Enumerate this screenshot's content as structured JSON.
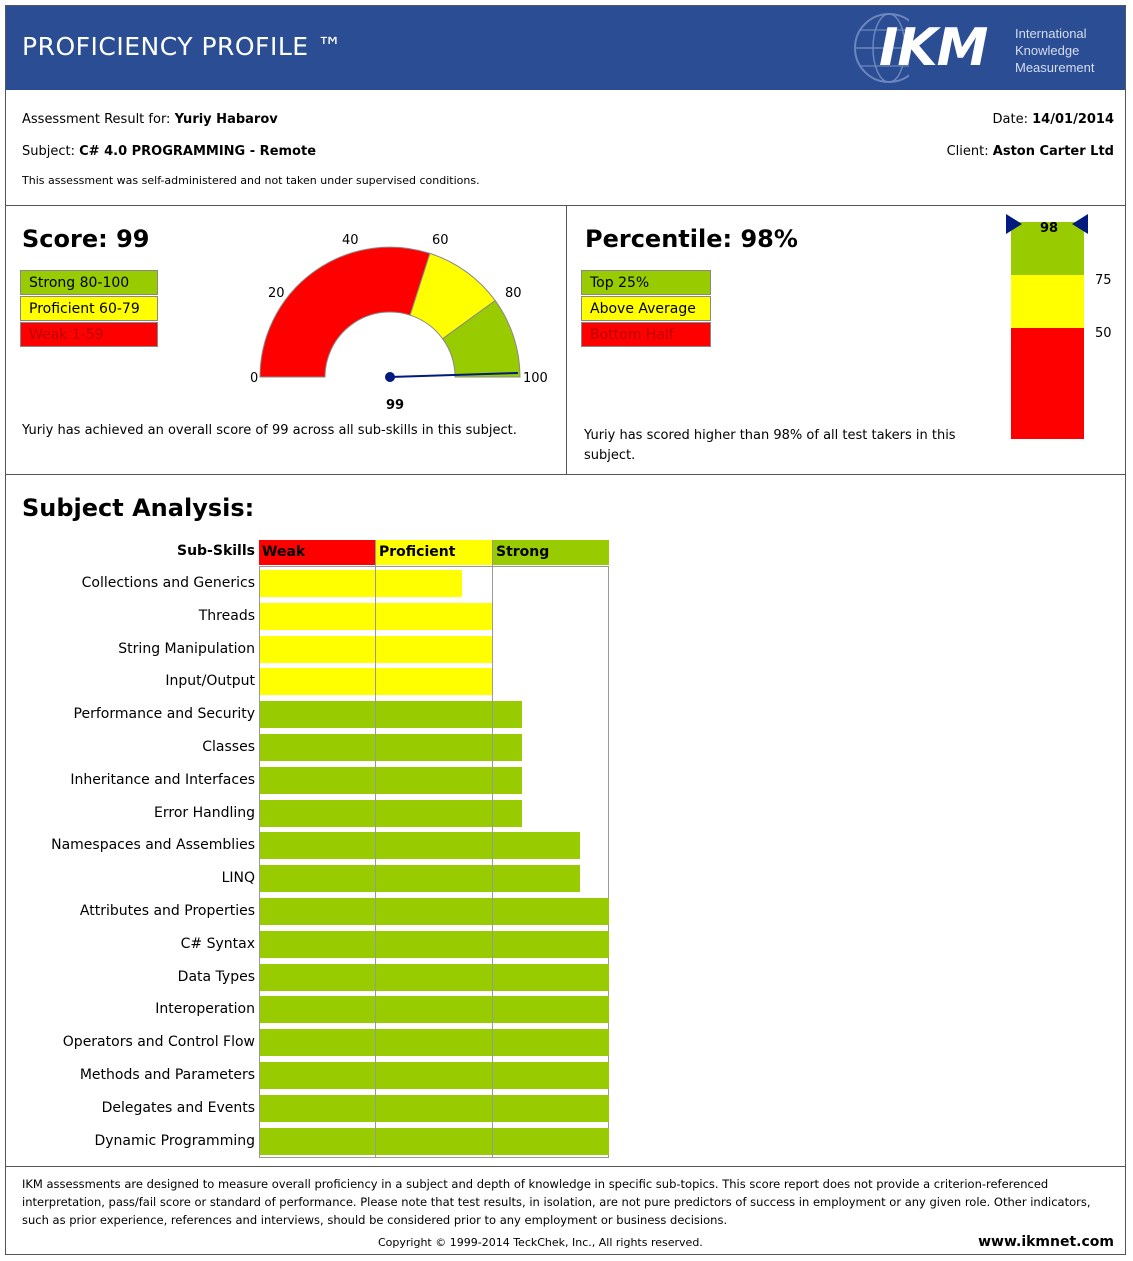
{
  "header": {
    "title": "PROFICIENCY PROFILE ™",
    "logo_text": "IKM",
    "logo_lines": [
      "International",
      "Knowledge",
      "Measurement"
    ]
  },
  "info": {
    "assessment_label": "Assessment Result for:",
    "candidate": "Yuriy Habarov",
    "subject_label": "Subject:",
    "subject": "C# 4.0 PROGRAMMING - Remote",
    "note": "This assessment was self-administered and not taken under supervised conditions.",
    "date_label": "Date:",
    "date": "14/01/2014",
    "client_label": "Client:",
    "client": "Aston Carter Ltd"
  },
  "score": {
    "title": "Score: 99",
    "value": 99,
    "legend": [
      "Strong 80-100",
      "Proficient 60-79",
      "Weak 1-59"
    ],
    "gauge_labels": [
      "0",
      "20",
      "40",
      "60",
      "80",
      "100"
    ],
    "gauge_value_label": "99",
    "summary": "Yuriy has achieved an overall score of 99 across all sub-skills in this subject."
  },
  "percentile": {
    "title": "Percentile: 98%",
    "value": 98,
    "legend": [
      "Top 25%",
      "Above Average",
      "Bottom Half"
    ],
    "marker_label": "98",
    "scale_labels": [
      "75",
      "50"
    ],
    "summary": "Yuriy has scored higher than 98% of all test takers in this subject."
  },
  "analysis": {
    "title": "Subject Analysis:",
    "subskills_header": "Sub-Skills",
    "columns": [
      "Weak",
      "Proficient",
      "Strong"
    ]
  },
  "chart_data": {
    "type": "bar",
    "orientation": "horizontal",
    "categories": [
      "Collections and Generics",
      "Threads",
      "String Manipulation",
      "Input/Output",
      "Performance and Security",
      "Classes",
      "Inheritance and Interfaces",
      "Error Handling",
      "Namespaces and Assemblies",
      "LINQ",
      "Attributes and Properties",
      "C# Syntax",
      "Data Types",
      "Interoperation",
      "Operators and Control Flow",
      "Methods and Parameters",
      "Delegates and Events",
      "Dynamic Programming"
    ],
    "values": [
      0.58,
      0.667,
      0.667,
      0.667,
      0.75,
      0.75,
      0.75,
      0.75,
      0.917,
      0.917,
      1.0,
      1.0,
      1.0,
      1.0,
      1.0,
      1.0,
      1.0,
      1.0
    ],
    "value_scale": "fraction of full scale (Weak | Proficient | Strong thirds)",
    "colors": {
      "weak": "#ff0000",
      "proficient": "#ffff00",
      "strong": "#99cc00"
    }
  },
  "footer": {
    "disclaimer": "IKM assessments are designed to measure overall proficiency in a subject and depth of knowledge in specific sub-topics. This score report does not provide a criterion-referenced interpretation, pass/fail score or standard of performance. Please note that test results, in isolation, are not pure predictors of success in employment or any given role. Other indicators, such as prior experience, references and interviews, should be considered prior to any employment or business decisions.",
    "copyright": "Copyright © 1999-2014 TeckChek, Inc., All rights reserved.",
    "website": "www.ikmnet.com"
  }
}
